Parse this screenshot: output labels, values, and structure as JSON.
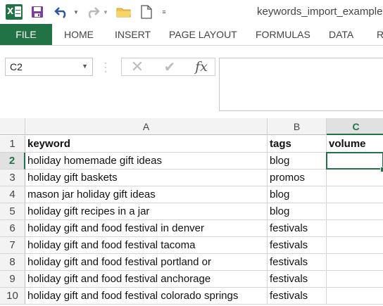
{
  "app": {
    "name": "Excel",
    "logo_letter": "X"
  },
  "quick_access": {
    "more": "≡"
  },
  "document": {
    "title": "keywords_import_example-"
  },
  "ribbon": {
    "tabs": [
      {
        "label": "FILE"
      },
      {
        "label": "HOME"
      },
      {
        "label": "INSERT"
      },
      {
        "label": "PAGE LAYOUT"
      },
      {
        "label": "FORMULAS"
      },
      {
        "label": "DATA"
      },
      {
        "label": "R"
      }
    ]
  },
  "formula_bar": {
    "name_box": "C2",
    "cancel": "✕",
    "enter": "✔",
    "fx": "fx",
    "value": ""
  },
  "sheet": {
    "columns": [
      "A",
      "B",
      "C"
    ],
    "active_column": "C",
    "active_row": "2",
    "rows": [
      {
        "num": "1",
        "a": "keyword",
        "b": "tags",
        "c": "volume"
      },
      {
        "num": "2",
        "a": "holiday homemade gift ideas",
        "b": "blog",
        "c": ""
      },
      {
        "num": "3",
        "a": "holiday gift baskets",
        "b": "promos",
        "c": ""
      },
      {
        "num": "4",
        "a": "mason jar holiday gift ideas",
        "b": "blog",
        "c": ""
      },
      {
        "num": "5",
        "a": "holiday gift recipes in a jar",
        "b": "blog",
        "c": ""
      },
      {
        "num": "6",
        "a": "holiday gift and food festival in denver",
        "b": "festivals",
        "c": ""
      },
      {
        "num": "7",
        "a": "holiday gift and food festival tacoma",
        "b": "festivals",
        "c": ""
      },
      {
        "num": "8",
        "a": "holiday gift and food festival portland or",
        "b": "festivals",
        "c": ""
      },
      {
        "num": "9",
        "a": "holiday gift and food festival anchorage",
        "b": "festivals",
        "c": ""
      },
      {
        "num": "10",
        "a": "holiday gift and food festival colorado springs",
        "b": "festivals",
        "c": ""
      }
    ]
  },
  "colors": {
    "accent": "#217346"
  }
}
